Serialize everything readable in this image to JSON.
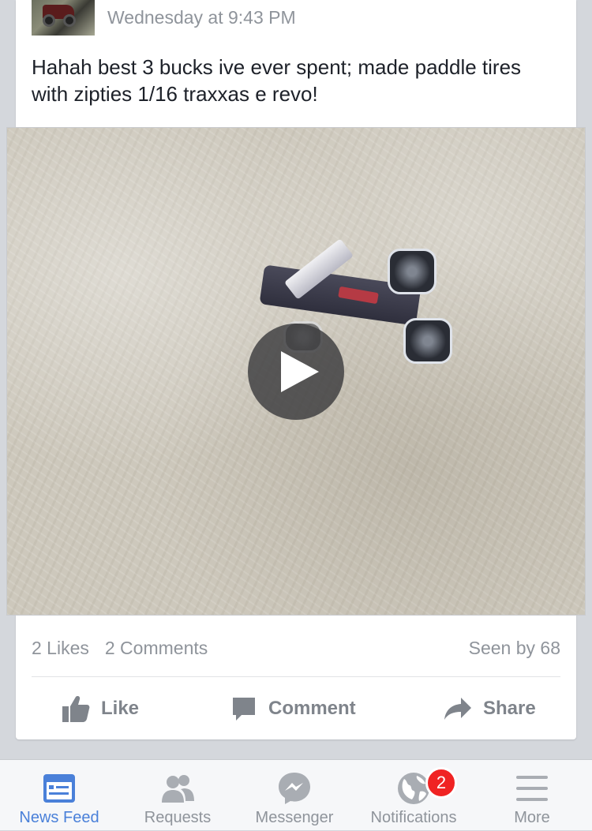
{
  "post": {
    "timestamp": "Wednesday at 9:43 PM",
    "text": "Hahah best 3 bucks ive ever spent; made paddle tires with zipties 1/16 traxxas e revo!",
    "video": {
      "play_icon": "play-icon"
    }
  },
  "stats": {
    "likes": "2 Likes",
    "comments": "2 Comments",
    "seen_by": "Seen by 68"
  },
  "actions": {
    "like": "Like",
    "comment": "Comment",
    "share": "Share"
  },
  "tabbar": {
    "news_feed": "News Feed",
    "requests": "Requests",
    "messenger": "Messenger",
    "notifications": "Notifications",
    "notifications_badge": "2",
    "more": "More"
  },
  "colors": {
    "accent": "#4a80d9",
    "muted": "#8f949b",
    "badge": "#f02323"
  }
}
